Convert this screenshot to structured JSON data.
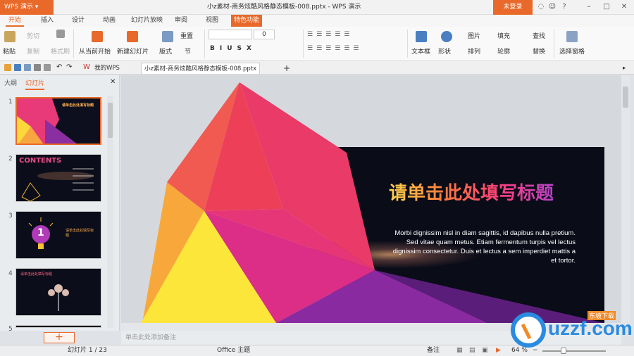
{
  "app": {
    "name": "WPS 演示",
    "doc_title": "小z素材-商务炫酷风格静态模板-008.pptx - WPS 演示",
    "login_label": "未登录"
  },
  "tabs": [
    "开始",
    "插入",
    "设计",
    "动画",
    "幻灯片放映",
    "审阅",
    "视图",
    "特色功能"
  ],
  "ribbon": {
    "paste": "粘贴",
    "cut": "剪切",
    "copy": "复制",
    "format_painter": "格式刷",
    "from_current": "从当前开始",
    "new_slide": "新建幻灯片",
    "layout": "版式",
    "section": "节",
    "reset": "重置",
    "font_size": "0",
    "textbox": "文本框",
    "shape": "形状",
    "arrange": "排列",
    "outline": "轮廓",
    "picture": "图片",
    "fill": "填充",
    "find": "查找",
    "replace": "替换",
    "select_pane": "选择窗格"
  },
  "doc_tabs": {
    "home": "我的WPS",
    "file": "小z素材-商务炫酷风格静态模板-008.pptx"
  },
  "panel": {
    "tab_outline": "大纲",
    "tab_slides": "幻灯片",
    "thumb_numbers": [
      "1",
      "2",
      "3",
      "4",
      "5"
    ]
  },
  "slide": {
    "title": "请单击此处填写标题",
    "body": "Morbi dignissim nisl in diam sagittis, id dapibus nulla pretium. Sed vitae quam metus. Etiam fermentum turpis vel lectus dignissim consectetur. Duis et lectus a sem imperdiet mattis a et tortor."
  },
  "thumbs": {
    "t1_title": "请单击此处填写标题",
    "t2_title": "CONTENTS",
    "t3_number": "1",
    "t3_text": "请单击此处填写标题",
    "t4_text": "请单击此处填写标题"
  },
  "notes_placeholder": "单击此处添加备注",
  "status": {
    "slide_count": "幻灯片 1 / 23",
    "theme": "Office 主题",
    "notes": "备注",
    "zoom": "64 %"
  },
  "watermark": {
    "site": "uzzf.com",
    "tag": "东坡下载"
  },
  "colors": {
    "accent": "#e8692a"
  }
}
